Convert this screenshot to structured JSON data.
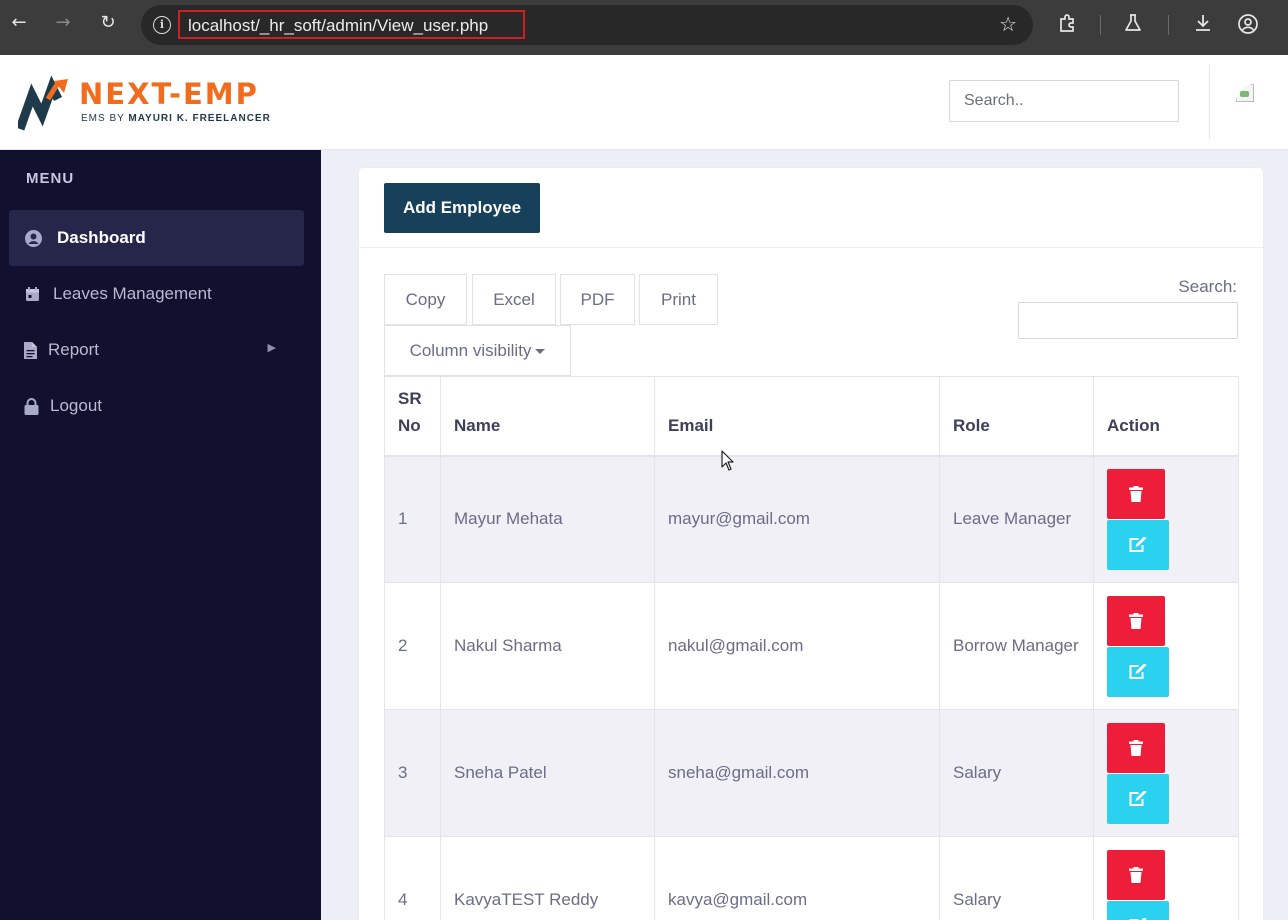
{
  "browser": {
    "url": "localhost/_hr_soft/admin/View_user.php",
    "icons": [
      "back-arrow-icon",
      "forward-arrow-icon",
      "reload-icon",
      "site-info-icon",
      "bookmark-star-icon",
      "extensions-icon",
      "labs-flask-icon",
      "download-icon",
      "profile-icon"
    ]
  },
  "header": {
    "brand": "NEXT-EMP",
    "brand_sub_prefix": "EMS BY ",
    "brand_sub_bold": "MAYURI K. FREELANCER",
    "search_placeholder": "Search..",
    "colors": {
      "brand_orange": "#f26c1e",
      "brand_navy": "#1f3a4b"
    }
  },
  "sidebar": {
    "menu_title": "MENU",
    "items": [
      {
        "label": "Dashboard",
        "icon": "user-circle-icon",
        "active": true
      },
      {
        "label": "Leaves Management",
        "icon": "calendar-icon",
        "active": false
      },
      {
        "label": "Report",
        "icon": "file-icon",
        "active": false,
        "has_submenu": true
      },
      {
        "label": "Logout",
        "icon": "lock-icon",
        "active": false
      }
    ],
    "colors": {
      "background": "#11102e",
      "active": "#26264a"
    }
  },
  "main": {
    "add_button": "Add Employee",
    "table_buttons": [
      "Copy",
      "Excel",
      "PDF",
      "Print"
    ],
    "column_visibility": "Column visibility",
    "search_label": "Search:",
    "columns": [
      "SR No",
      "Name",
      "Email",
      "Role",
      "Action"
    ],
    "rows": [
      {
        "sr": "1",
        "name": "Mayur Mehata",
        "email": "mayur@gmail.com",
        "role": "Leave Manager"
      },
      {
        "sr": "2",
        "name": "Nakul Sharma",
        "email": "nakul@gmail.com",
        "role": "Borrow Manager"
      },
      {
        "sr": "3",
        "name": "Sneha Patel",
        "email": "sneha@gmail.com",
        "role": "Salary"
      },
      {
        "sr": "4",
        "name": "KavyaTEST Reddy",
        "email": "kavya@gmail.com",
        "role": "Salary"
      }
    ],
    "action_icons": [
      "trash-icon",
      "edit-icon"
    ],
    "colors": {
      "add_button": "#17405a",
      "delete": "#ee1d3a",
      "edit": "#2bd2f0"
    }
  }
}
